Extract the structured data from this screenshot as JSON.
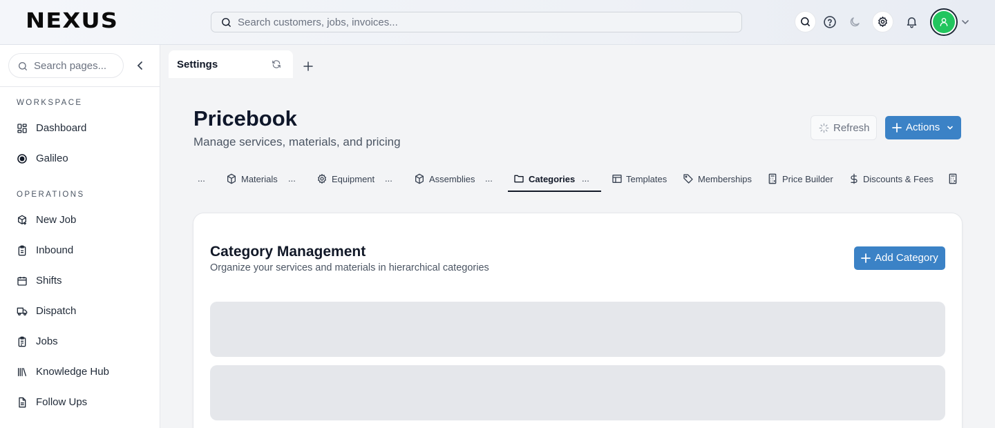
{
  "app": {
    "logo_text": "NEXUS"
  },
  "header": {
    "search_placeholder": "Search customers, jobs, invoices...",
    "icons": [
      "search-icon",
      "help-icon",
      "moon-icon",
      "gear-icon",
      "bell-icon",
      "user-icon",
      "chevron-down-icon"
    ],
    "avatar_color": "#22c55e"
  },
  "sidebar": {
    "search_placeholder": "Search pages...",
    "sections": [
      {
        "label": "WORKSPACE",
        "items": [
          {
            "label": "Dashboard",
            "icon": "grid-icon"
          },
          {
            "label": "Galileo",
            "icon": "target-icon"
          }
        ]
      },
      {
        "label": "OPERATIONS",
        "items": [
          {
            "label": "New Job",
            "icon": "box-plus-icon"
          },
          {
            "label": "Inbound",
            "icon": "clipboard-icon"
          },
          {
            "label": "Shifts",
            "icon": "calendar-icon"
          },
          {
            "label": "Dispatch",
            "icon": "truck-icon"
          },
          {
            "label": "Jobs",
            "icon": "clipboard-list-icon"
          },
          {
            "label": "Knowledge Hub",
            "icon": "library-icon"
          },
          {
            "label": "Follow Ups",
            "icon": "file-text-icon"
          }
        ]
      }
    ]
  },
  "tabs": [
    {
      "label": "Settings"
    }
  ],
  "page": {
    "title": "Pricebook",
    "subtitle": "Manage services, materials, and pricing",
    "refresh_label": "Refresh",
    "actions_label": "Actions"
  },
  "subtabs": [
    {
      "label": "Materials",
      "icon": "package-icon"
    },
    {
      "label": "Equipment",
      "icon": "gear-icon"
    },
    {
      "label": "Assemblies",
      "icon": "package-icon"
    },
    {
      "label": "Categories",
      "icon": "folder-icon",
      "active": true
    },
    {
      "label": "Templates",
      "icon": "layout-icon"
    },
    {
      "label": "Memberships",
      "icon": "tag-icon"
    },
    {
      "label": "Price Builder",
      "icon": "calculator-icon"
    },
    {
      "label": "Discounts & Fees",
      "icon": "dollar-icon"
    }
  ],
  "subtab_overflow": "...",
  "card": {
    "title": "Category Management",
    "subtitle": "Organize your services and materials in hierarchical categories",
    "add_label": "Add Category"
  },
  "colors": {
    "primary": "#3b82c6",
    "skeleton": "#e5e7eb"
  }
}
